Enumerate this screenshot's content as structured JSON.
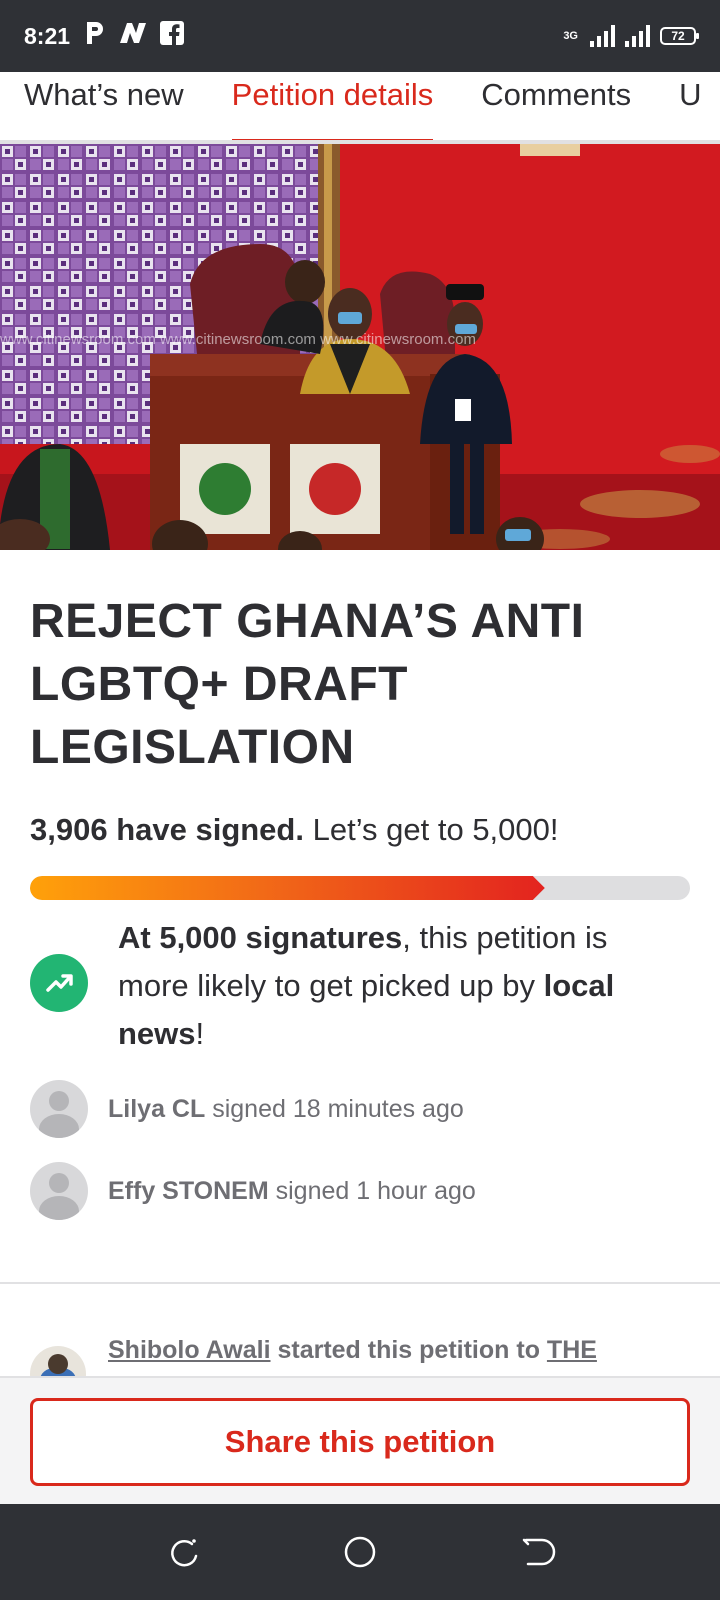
{
  "status_bar": {
    "time": "8:21",
    "notification_icons": [
      "p-app-icon",
      "n-app-icon",
      "facebook-icon"
    ],
    "network_label": "3G",
    "battery_level": "72"
  },
  "tabs": [
    {
      "label": "What’s new",
      "active": false
    },
    {
      "label": "Petition details",
      "active": true
    },
    {
      "label": "Comments",
      "active": false
    },
    {
      "label": "U",
      "active": false
    }
  ],
  "hero_watermark": "www.citinewsroom.com www.citinewsroom.com www.citinewsroom.com",
  "petition": {
    "title": "REJECT GHANA’S ANTI LGBTQ+ DRAFT LEGISLATION",
    "signed_count_text": "3,906 have signed.",
    "goal_text": "Let’s get to 5,000!",
    "signed_count": 3906,
    "goal": 5000,
    "progress_fraction": 0.78
  },
  "milestone": {
    "bold_1": "At 5,000 signatures",
    "text_1": ", this petition is more likely to get picked up by ",
    "bold_2": "local news",
    "text_2": "!"
  },
  "recent_signers": [
    {
      "name": "Lilya CL",
      "action": "signed 18 minutes ago"
    },
    {
      "name": "Effy STONEM",
      "action": "signed 1 hour ago"
    }
  ],
  "starter": {
    "name": "Shibolo Awali",
    "middle": " started this petition to ",
    "target": "THE"
  },
  "share_button_label": "Share this petition",
  "colors": {
    "accent": "#d9291c",
    "status_bar": "#2f3136",
    "milestone_icon": "#22b573"
  }
}
